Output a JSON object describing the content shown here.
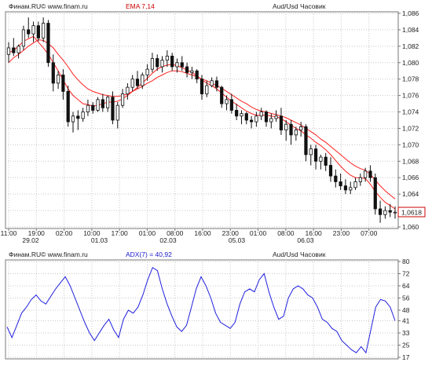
{
  "colors": {
    "background": "#ffffff",
    "grid": "#c8c8c8",
    "candle": "#111111",
    "ema_line": "#ff2020",
    "adx_line": "#2020dd",
    "ema_label": "#cc0000",
    "adx_label": "#1a1acc"
  },
  "price_panel": {
    "source_label": "Финам.RU©  www.finam.ru",
    "indicator_label": "EMA 7,14",
    "instrument_label": "Aud/Usd Часовик",
    "last_price_label": "1,0618"
  },
  "adx_panel": {
    "source_label": "Финам.RU©  www.finam.ru",
    "indicator_label": "ADX(7) = 40,92",
    "instrument_label": "Aud/Usd Часовик"
  },
  "chart_data": [
    {
      "type": "candlestick",
      "title": "Aud/Usd Часовик",
      "indicator": "EMA 7,14",
      "ylim": [
        1.06,
        1.086
      ],
      "y_ticks": [
        "1,086",
        "1,084",
        "1,082",
        "1,080",
        "1,078",
        "1,076",
        "1,074",
        "1,072",
        "1,070",
        "1,068",
        "1,066",
        "1,064",
        "1,062",
        "1,060"
      ],
      "x_tick_labels": [
        "11:00",
        "19:00",
        "02:00",
        "10:00",
        "17:00",
        "01:00",
        "08:00",
        "16:00",
        "23:00",
        "01:00",
        "08:00",
        "16:00",
        "23:00",
        "07:00"
      ],
      "date_labels": [
        "29.02",
        "01.03",
        "02.03",
        "05.03",
        "06.03"
      ],
      "last_price": 1.0618,
      "ohlc": [
        [
          1.081,
          1.0825,
          1.08,
          1.0818
        ],
        [
          1.0818,
          1.083,
          1.0808,
          1.0812
        ],
        [
          1.0812,
          1.0822,
          1.0805,
          1.082
        ],
        [
          1.082,
          1.0845,
          1.0815,
          1.084
        ],
        [
          1.084,
          1.0855,
          1.083,
          1.0835
        ],
        [
          1.0835,
          1.085,
          1.0825,
          1.0845
        ],
        [
          1.0845,
          1.085,
          1.0826,
          1.083
        ],
        [
          1.083,
          1.0855,
          1.0825,
          1.0848
        ],
        [
          1.0848,
          1.0852,
          1.0795,
          1.08
        ],
        [
          1.08,
          1.081,
          1.0765,
          1.0775
        ],
        [
          1.0775,
          1.079,
          1.0768,
          1.0785
        ],
        [
          1.0785,
          1.0792,
          1.0755,
          1.0765
        ],
        [
          1.0765,
          1.0772,
          1.0722,
          1.0728
        ],
        [
          1.0728,
          1.074,
          1.0715,
          1.0735
        ],
        [
          1.0735,
          1.0742,
          1.0718,
          1.0732
        ],
        [
          1.0732,
          1.0745,
          1.0728,
          1.074
        ],
        [
          1.074,
          1.0755,
          1.0735,
          1.0748
        ],
        [
          1.0748,
          1.0752,
          1.0738,
          1.0742
        ],
        [
          1.0742,
          1.0758,
          1.074,
          1.0755
        ],
        [
          1.0755,
          1.0762,
          1.074,
          1.0745
        ],
        [
          1.0745,
          1.076,
          1.074,
          1.0758
        ],
        [
          1.0758,
          1.0765,
          1.0725,
          1.073
        ],
        [
          1.073,
          1.0752,
          1.072,
          1.0748
        ],
        [
          1.0748,
          1.0768,
          1.0745,
          1.0762
        ],
        [
          1.0762,
          1.0775,
          1.0755,
          1.077
        ],
        [
          1.077,
          1.0785,
          1.0765,
          1.078
        ],
        [
          1.078,
          1.079,
          1.0768,
          1.0772
        ],
        [
          1.0772,
          1.0788,
          1.0768,
          1.0785
        ],
        [
          1.0785,
          1.0798,
          1.0778,
          1.0792
        ],
        [
          1.0792,
          1.0812,
          1.0788,
          1.0805
        ],
        [
          1.0805,
          1.081,
          1.079,
          1.0795
        ],
        [
          1.0795,
          1.0808,
          1.0788,
          1.0803
        ],
        [
          1.0803,
          1.0815,
          1.0795,
          1.0808
        ],
        [
          1.0808,
          1.0812,
          1.079,
          1.0795
        ],
        [
          1.0795,
          1.0805,
          1.0788,
          1.08
        ],
        [
          1.08,
          1.0808,
          1.079,
          1.0795
        ],
        [
          1.0795,
          1.08,
          1.0782,
          1.0788
        ],
        [
          1.0788,
          1.0795,
          1.078,
          1.079
        ],
        [
          1.079,
          1.0792,
          1.0775,
          1.078
        ],
        [
          1.078,
          1.0785,
          1.0755,
          1.0762
        ],
        [
          1.0762,
          1.0778,
          1.0758,
          1.0772
        ],
        [
          1.0772,
          1.0782,
          1.077,
          1.0778
        ],
        [
          1.0778,
          1.0783,
          1.0765,
          1.077
        ],
        [
          1.077,
          1.0772,
          1.0745,
          1.075
        ],
        [
          1.075,
          1.076,
          1.0742,
          1.0755
        ],
        [
          1.0755,
          1.0762,
          1.0738,
          1.0742
        ],
        [
          1.0742,
          1.075,
          1.073,
          1.0735
        ],
        [
          1.0735,
          1.0742,
          1.0725,
          1.0738
        ],
        [
          1.0738,
          1.074,
          1.0725,
          1.073
        ],
        [
          1.073,
          1.0735,
          1.072,
          1.0728
        ],
        [
          1.0728,
          1.074,
          1.0722,
          1.0735
        ],
        [
          1.0735,
          1.0745,
          1.073,
          1.074
        ],
        [
          1.074,
          1.0742,
          1.0722,
          1.0728
        ],
        [
          1.0728,
          1.0738,
          1.072,
          1.0732
        ],
        [
          1.0732,
          1.0742,
          1.0728,
          1.0735
        ],
        [
          1.0735,
          1.0745,
          1.0712,
          1.0718
        ],
        [
          1.0718,
          1.073,
          1.0705,
          1.0725
        ],
        [
          1.0725,
          1.073,
          1.07,
          1.0712
        ],
        [
          1.0712,
          1.0722,
          1.0705,
          1.0718
        ],
        [
          1.0718,
          1.0728,
          1.071,
          1.0722
        ],
        [
          1.0722,
          1.0725,
          1.068,
          1.0688
        ],
        [
          1.0688,
          1.07,
          1.0675,
          1.0695
        ],
        [
          1.0695,
          1.07,
          1.067,
          1.068
        ],
        [
          1.068,
          1.0688,
          1.067,
          1.0685
        ],
        [
          1.0685,
          1.069,
          1.0668,
          1.0675
        ],
        [
          1.0675,
          1.0685,
          1.0655,
          1.0662
        ],
        [
          1.0662,
          1.067,
          1.0648,
          1.0655
        ],
        [
          1.0655,
          1.0665,
          1.0645,
          1.065
        ],
        [
          1.065,
          1.0658,
          1.064,
          1.0645
        ],
        [
          1.0645,
          1.0655,
          1.064,
          1.0648
        ],
        [
          1.0648,
          1.066,
          1.0645,
          1.0655
        ],
        [
          1.0655,
          1.0665,
          1.065,
          1.066
        ],
        [
          1.066,
          1.0672,
          1.0655,
          1.0668
        ],
        [
          1.0668,
          1.0675,
          1.0655,
          1.066
        ],
        [
          1.066,
          1.0665,
          1.0615,
          1.0622
        ],
        [
          1.0622,
          1.0632,
          1.0605,
          1.0615
        ],
        [
          1.0615,
          1.0625,
          1.061,
          1.062
        ],
        [
          1.062,
          1.0628,
          1.0612,
          1.0618
        ],
        [
          1.0618,
          1.0625,
          1.061,
          1.0618
        ]
      ],
      "ema_fast": [
        1.0812,
        1.0815,
        1.082,
        1.0826,
        1.0829,
        1.0832,
        1.0825,
        1.0818,
        1.081,
        1.08,
        1.079,
        1.0779,
        1.0768,
        1.076,
        1.0755,
        1.075,
        1.0749,
        1.0747,
        1.0748,
        1.075,
        1.0752,
        1.0752,
        1.0753,
        1.0756,
        1.076,
        1.0765,
        1.077,
        1.0775,
        1.0781,
        1.0787,
        1.0792,
        1.0795,
        1.0797,
        1.0798,
        1.0796,
        1.0794,
        1.0791,
        1.0788,
        1.0784,
        1.0779,
        1.0775,
        1.0772,
        1.0768,
        1.0763,
        1.0758,
        1.0753,
        1.0749,
        1.0745,
        1.0741,
        1.0738,
        1.0736,
        1.0736,
        1.0736,
        1.0735,
        1.0734,
        1.0732,
        1.0728,
        1.0724,
        1.072,
        1.0717,
        1.0712,
        1.0708,
        1.0703,
        1.0699,
        1.0694,
        1.0688,
        1.0681,
        1.0674,
        1.0668,
        1.0663,
        1.066,
        1.066,
        1.0659,
        1.0652,
        1.0643,
        1.0636,
        1.063,
        1.0626,
        1.0622
      ],
      "ema_slow": [
        1.08,
        1.0806,
        1.081,
        1.0815,
        1.082,
        1.0824,
        1.0828,
        1.0827,
        1.0823,
        1.0818,
        1.081,
        1.0803,
        1.0795,
        1.0786,
        1.0779,
        1.0773,
        1.0768,
        1.0765,
        1.0763,
        1.0761,
        1.076,
        1.0759,
        1.0759,
        1.076,
        1.0762,
        1.0765,
        1.0768,
        1.0771,
        1.0775,
        1.0778,
        1.0782,
        1.0785,
        1.0788,
        1.079,
        1.079,
        1.0789,
        1.0787,
        1.0785,
        1.0783,
        1.078,
        1.0778,
        1.0775,
        1.0772,
        1.0769,
        1.0765,
        1.0761,
        1.0757,
        1.0753,
        1.075,
        1.0746,
        1.0743,
        1.0741,
        1.074,
        1.0738,
        1.0737,
        1.0735,
        1.0733,
        1.073,
        1.0727,
        1.0724,
        1.072,
        1.0716,
        1.0712,
        1.0707,
        1.0703,
        1.0698,
        1.0693,
        1.0688,
        1.0683,
        1.0678,
        1.0674,
        1.0671,
        1.0669,
        1.0664,
        1.0657,
        1.065,
        1.0644,
        1.0639,
        1.0634
      ]
    },
    {
      "type": "line",
      "title": "Aud/Usd Часовик",
      "indicator": "ADX(7) = 40,92",
      "ylim": [
        17,
        80
      ],
      "y_ticks": [
        "80",
        "72",
        "64",
        "56",
        "48",
        "41",
        "33",
        "25",
        "17"
      ],
      "current_value": 40.92,
      "series": [
        {
          "name": "ADX(7)",
          "values": [
            37,
            30,
            38,
            46,
            50,
            55,
            58,
            54,
            52,
            57,
            62,
            66,
            70,
            64,
            56,
            48,
            40,
            33,
            28,
            33,
            38,
            42,
            35,
            30,
            42,
            48,
            46,
            50,
            58,
            68,
            76,
            74,
            62,
            52,
            44,
            37,
            34,
            38,
            50,
            62,
            70,
            64,
            56,
            46,
            40,
            38,
            36,
            40,
            52,
            60,
            62,
            60,
            68,
            72,
            60,
            50,
            42,
            44,
            56,
            62,
            64,
            62,
            58,
            56,
            50,
            42,
            40,
            36,
            34,
            28,
            25,
            22,
            20,
            24,
            20,
            35,
            50,
            55,
            54,
            50,
            41
          ]
        }
      ]
    }
  ]
}
